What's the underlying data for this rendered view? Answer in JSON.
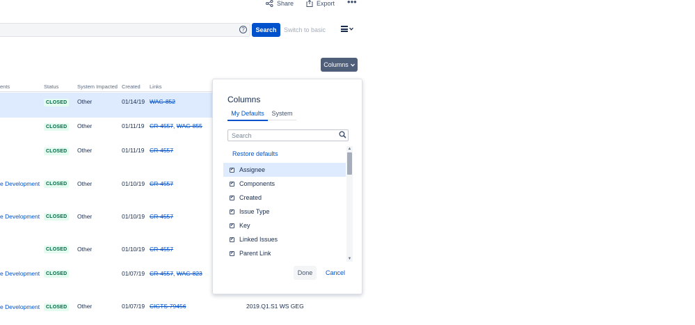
{
  "top_actions": {
    "share_label": "Share",
    "export_label": "Export",
    "more_label": "•••"
  },
  "search_bar": {
    "help_label": "?",
    "search_button": "Search",
    "switch_label": "Switch to basic"
  },
  "columns_button": {
    "label": "Columns"
  },
  "table": {
    "headers": {
      "components": "ents",
      "status": "Status",
      "system_impacted": "System Impacted",
      "created": "Created",
      "links": "Links"
    },
    "rows": [
      {
        "component": "",
        "status": "CLOSED",
        "system": "Other",
        "created": "01/14/19",
        "link1": "WAG-852",
        "sep": "",
        "link2": "",
        "sprint": ""
      },
      {
        "component": "",
        "status": "CLOSED",
        "system": "Other",
        "created": "01/11/19",
        "link1": "CR-4557",
        "sep": ",",
        "link2": "WAG-855",
        "sprint": ""
      },
      {
        "component": "",
        "status": "CLOSED",
        "system": "Other",
        "created": "01/11/19",
        "link1": "CR-4557",
        "sep": "",
        "link2": "",
        "sprint": ""
      },
      {
        "component": "e Development",
        "status": "CLOSED",
        "system": "Other",
        "created": "01/10/19",
        "link1": "CR-4557",
        "sep": "",
        "link2": "",
        "sprint": ""
      },
      {
        "component": "e Development",
        "status": "CLOSED",
        "system": "Other",
        "created": "01/10/19",
        "link1": "CR-4557",
        "sep": "",
        "link2": "",
        "sprint": ""
      },
      {
        "component": "",
        "status": "CLOSED",
        "system": "Other",
        "created": "01/10/19",
        "link1": "CR-4557",
        "sep": "",
        "link2": "",
        "sprint": ""
      },
      {
        "component": "e Development",
        "status": "CLOSED",
        "system": "",
        "created": "01/07/19",
        "link1": "CR-4557",
        "sep": ",",
        "link2": "WAG-823",
        "sprint": ""
      },
      {
        "component": "e Development",
        "status": "CLOSED",
        "system": "Other",
        "created": "01/07/19",
        "link1": "CIGTS-79456",
        "sep": "",
        "link2": "",
        "sprint": "2019.Q1.S1 WS GEG"
      }
    ]
  },
  "columns_popup": {
    "title": "Columns",
    "tabs": [
      "My Defaults",
      "System"
    ],
    "search_placeholder": "Search",
    "restore_label": "Restore defaults",
    "options": [
      {
        "label": "Assignee",
        "checked": true
      },
      {
        "label": "Components",
        "checked": true
      },
      {
        "label": "Created",
        "checked": true
      },
      {
        "label": "Issue Type",
        "checked": true
      },
      {
        "label": "Key",
        "checked": true
      },
      {
        "label": "Linked Issues",
        "checked": true
      },
      {
        "label": "Parent Link",
        "checked": true
      }
    ],
    "check_glyph": "✔",
    "scroll_up": "▲",
    "scroll_down": "▼",
    "done_label": "Done",
    "cancel_label": "Cancel"
  },
  "colors": {
    "primary": "#0052cc",
    "closed_bg": "#e3fcef",
    "closed_text": "#006644",
    "selected_row": "#deebff",
    "columns_button": "#505f79"
  }
}
